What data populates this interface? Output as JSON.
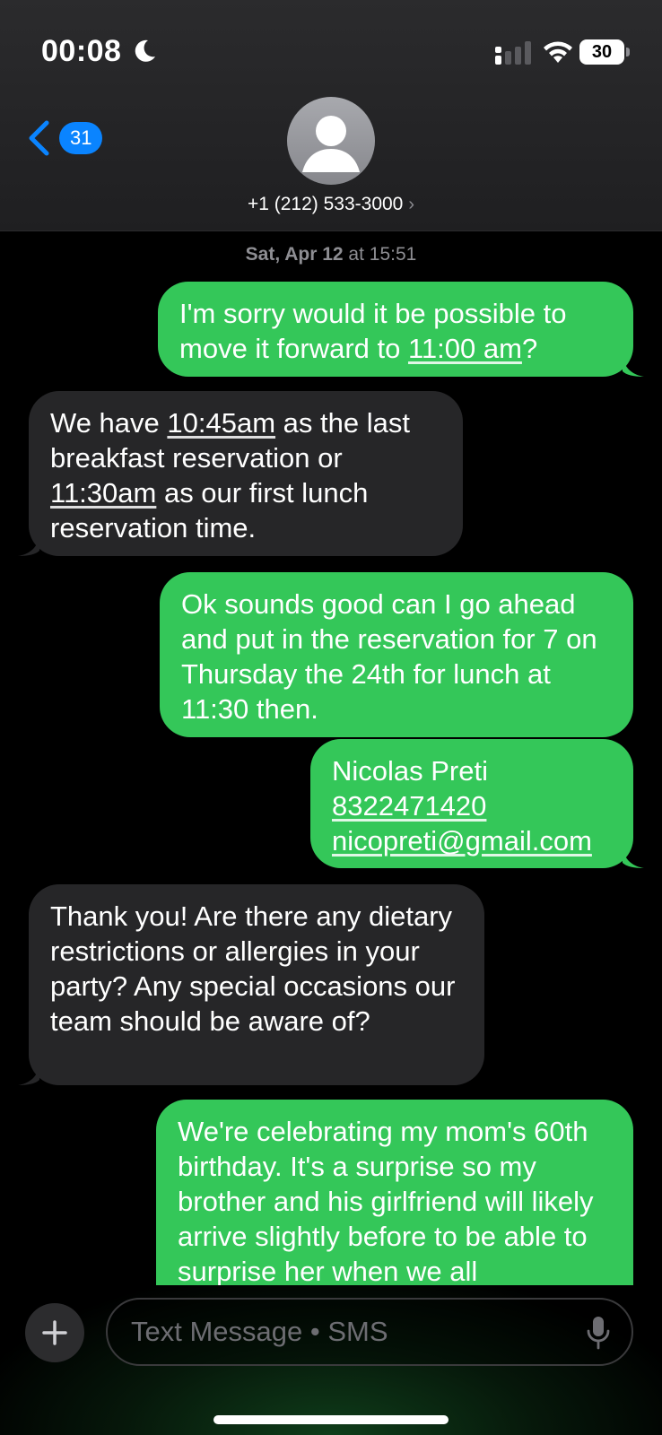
{
  "status": {
    "time": "00:08",
    "battery": "30",
    "icons": [
      "moon-icon",
      "signal-icon",
      "wifi-icon",
      "battery-icon"
    ]
  },
  "header": {
    "back_badge": "31",
    "contact": "+1 (212) 533-3000"
  },
  "thread": {
    "timestamp_day": "Sat, Apr 12",
    "timestamp_at": "at",
    "timestamp_time": "15:51",
    "messages": [
      {
        "type": "sent",
        "parts": [
          "I'm sorry would it be possible to move it forward to ",
          "11:00 am",
          "?"
        ]
      },
      {
        "type": "received",
        "parts": [
          "We have ",
          "10:45am",
          " as the last breakfast reservation or ",
          "11:30am",
          " as our first lunch reservation time."
        ]
      },
      {
        "type": "sent",
        "text": "Ok sounds good can I go ahead and put in the reservation for 7 on Thursday the 24th for lunch at 11:30 then."
      },
      {
        "type": "sent",
        "lines": [
          "Nicolas Preti",
          "8322471420",
          "nicopreti@gmail.com"
        ]
      },
      {
        "type": "received",
        "text": "Thank you!  Are there any dietary restrictions or allergies in your party? Any special occasions our team should be aware of?"
      },
      {
        "type": "sent",
        "text": "We're celebrating my mom's 60th birthday. It's a surprise so my brother and his girlfriend will likely arrive slightly before to be able to surprise her when we all"
      }
    ]
  },
  "composer": {
    "placeholder": "Text Message • SMS"
  },
  "colors": {
    "sent_bubble": "#34c759",
    "received_bubble": "#262628",
    "accent": "#0a84ff"
  }
}
